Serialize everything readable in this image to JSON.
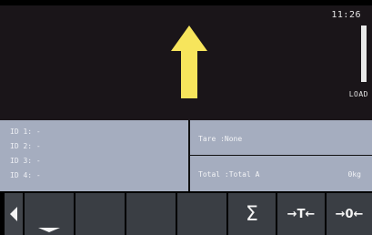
{
  "status": {
    "clock": "11:26",
    "load_label": "LOAD"
  },
  "indicator": {
    "icon": "up-arrow-icon",
    "color": "#f7e55c"
  },
  "ids": [
    {
      "label": "ID 1: -"
    },
    {
      "label": "ID 2: -"
    },
    {
      "label": "ID 3: -"
    },
    {
      "label": "ID 4: -"
    }
  ],
  "tare": {
    "label": "Tare :None"
  },
  "total": {
    "label": "Total :Total A",
    "weight": "0kg"
  },
  "softkeys": {
    "left_icon": "left-triangle-icon",
    "down_icon": "down-caret-icon",
    "sum_label": "Σ",
    "tare_label": "→T←",
    "zero_label": "→0←"
  },
  "colors": {
    "panel_bg": "#a5adbf",
    "display_bg": "#1a1519",
    "key_bg": "#3a3e44"
  }
}
